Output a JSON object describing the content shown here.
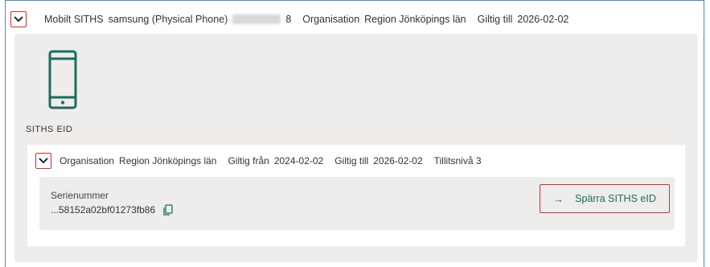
{
  "header": {
    "type_label": "Mobilt SITHS",
    "device": "samsung (Physical Phone)",
    "device_id_suffix": "8",
    "org_label": "Organisation",
    "org_value": "Region Jönköpings län",
    "valid_to_label": "Giltig till",
    "valid_to_value": "2026-02-02"
  },
  "card": {
    "icon": "mobile-phone-icon",
    "section_label": "SITHS EID",
    "cert": {
      "org_label": "Organisation",
      "org_value": "Region Jönköpings län",
      "valid_from_label": "Giltig från",
      "valid_from_value": "2024-02-02",
      "valid_to_label": "Giltig till",
      "valid_to_value": "2026-02-02",
      "trust_level": "Tillitsnivå 3",
      "serial_label": "Serienummer",
      "serial_value": "...58152a02bf01273fb86",
      "revoke_label": "Spärra SITHS eID",
      "revoke_arrow": "→"
    }
  },
  "colors": {
    "accent": "#1a6d5e",
    "highlight": "#d62b2b",
    "frame": "#4a86c8",
    "panel_bg": "#efedeb"
  }
}
